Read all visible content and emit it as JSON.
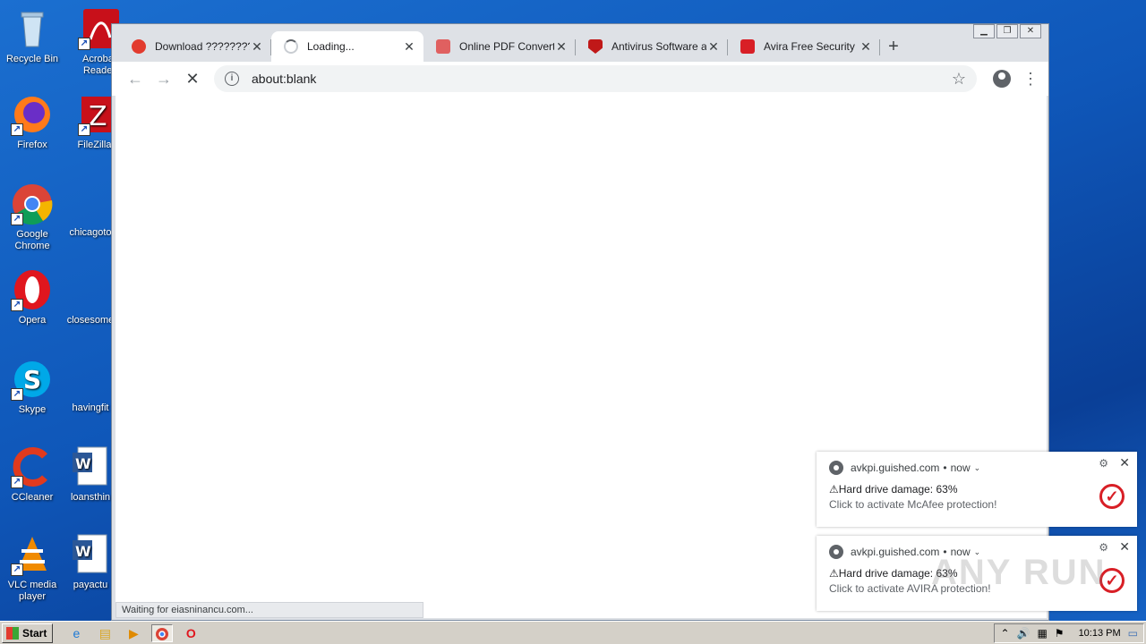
{
  "desktop": {
    "icons": [
      {
        "label": "Recycle Bin",
        "icon": "recycle-bin-icon"
      },
      {
        "label": "Acrobat Reader",
        "icon": "acrobat-icon"
      },
      {
        "label": "Firefox",
        "icon": "firefox-icon"
      },
      {
        "label": "FileZilla C",
        "icon": "filezilla-icon"
      },
      {
        "label": "Google Chrome",
        "icon": "chrome-icon"
      },
      {
        "label": "chicagoto",
        "icon": "file-icon"
      },
      {
        "label": "Opera",
        "icon": "opera-icon"
      },
      {
        "label": "closesome",
        "icon": "file-icon"
      },
      {
        "label": "Skype",
        "icon": "skype-icon"
      },
      {
        "label": "havingfit",
        "icon": "file-icon"
      },
      {
        "label": "CCleaner",
        "icon": "ccleaner-icon"
      },
      {
        "label": "loansthin",
        "icon": "word-icon"
      },
      {
        "label": "VLC media player",
        "icon": "vlc-icon"
      },
      {
        "label": "payactu",
        "icon": "word-icon"
      }
    ]
  },
  "browser": {
    "tabs": [
      {
        "title": "Download ?????????? ",
        "favicon_color": "#e23b2e",
        "active": false
      },
      {
        "title": "Loading...",
        "favicon_color": "#c9cdd2",
        "active": true
      },
      {
        "title": "Online PDF Converter",
        "favicon_color": "#e06060",
        "active": false
      },
      {
        "title": "Antivirus Software an",
        "favicon_color": "#c01818",
        "active": false
      },
      {
        "title": "Avira Free Security",
        "favicon_color": "#d81f26",
        "active": false
      }
    ],
    "url": "about:blank",
    "status": "Waiting for eiasninancu.com..."
  },
  "notifications": [
    {
      "site": "avkpi.guished.com",
      "time": "now",
      "title": "⚠Hard drive damage: 63%",
      "body": "Click to activate McAfee protection!"
    },
    {
      "site": "avkpi.guished.com",
      "time": "now",
      "title": "⚠Hard drive damage: 63%",
      "body": "Click to activate AVIRA protection!"
    }
  ],
  "watermark": "ANY RUN",
  "taskbar": {
    "start_label": "Start",
    "clock": "10:13 PM"
  }
}
